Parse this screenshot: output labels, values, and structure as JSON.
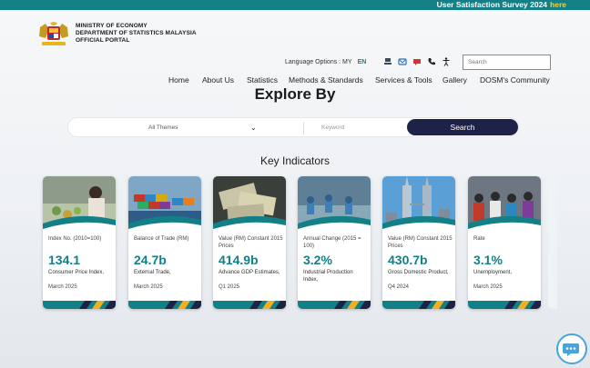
{
  "top_bar": {
    "survey_text": "User Satisfaction Survey 2024",
    "here_link": "here"
  },
  "header": {
    "ministry_lines": [
      "MINISTRY OF ECONOMY",
      "DEPARTMENT OF STATISTICS MALAYSIA",
      "OFFICIAL PORTAL"
    ],
    "language_label": "Language Options : MY",
    "language_active": "EN",
    "search_placeholder": "Search"
  },
  "nav": [
    "Home",
    "About Us",
    "Statistics",
    "Methods & Standards",
    "Services & Tools",
    "Gallery",
    "DOSM's Community"
  ],
  "explore": {
    "title": "Explore By",
    "themes_value": "All Themes",
    "keyword_placeholder": "Keyword",
    "search_button": "Search"
  },
  "key_indicators": {
    "title": "Key Indicators",
    "cards": [
      {
        "label": "Index No. (2010=100)",
        "value": "134.1",
        "desc": "Consumer Price Index,",
        "period": "March 2025",
        "image": "grocery-shopping"
      },
      {
        "label": "Balance of Trade (RM)",
        "value": "24.7b",
        "desc": "External Trade,",
        "period": "March 2025",
        "image": "shipping-containers"
      },
      {
        "label": "Value (RM) Constant 2015 Prices",
        "value": "414.9b",
        "desc": "Advance GDP Estimates,",
        "period": "Q1 2025",
        "image": "money-notes"
      },
      {
        "label": "Annual Change (2015 = 100)",
        "value": "3.2%",
        "desc": "Industrial Production Index,",
        "period": "",
        "image": "factory-workers"
      },
      {
        "label": "Value (RM) Constant 2015 Prices",
        "value": "430.7b",
        "desc": "Gross Domestic Product,",
        "period": "Q4 2024",
        "image": "twin-towers"
      },
      {
        "label": "Rate",
        "value": "3.1%",
        "desc": "Unemployment,",
        "period": "March 2025",
        "image": "job-fair-crowd"
      }
    ]
  },
  "colors": {
    "teal": "#137f86",
    "navy": "#1e2247",
    "gold": "#f2b01e",
    "here_yellow": "#f6d13a"
  }
}
